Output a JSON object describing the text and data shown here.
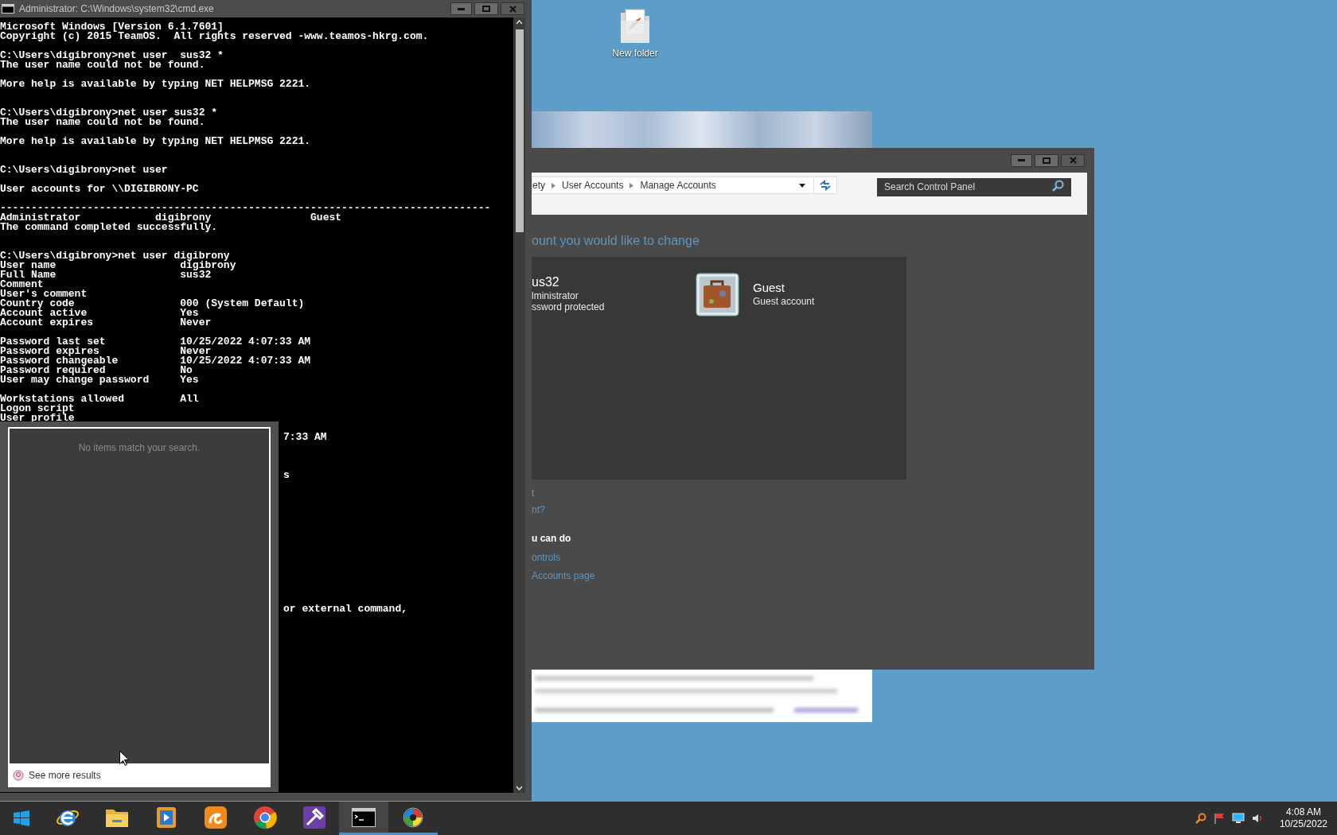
{
  "desktop": {
    "icons": [
      {
        "label": "New folder"
      }
    ]
  },
  "cmd_window": {
    "title": "Administrator: C:\\Windows\\system32\\cmd.exe",
    "lines": [
      {
        "kind": "text",
        "text": "Microsoft Windows [Version 6.1.7601]"
      },
      {
        "kind": "text",
        "text": "Copyright (c) 2015 TeamOS.  All rights reserved -www.teamos-hkrg.com."
      },
      {
        "kind": "blank"
      },
      {
        "kind": "text",
        "text": "C:\\Users\\digibrony>net user  sus32 *"
      },
      {
        "kind": "text",
        "text": "The user name could not be found."
      },
      {
        "kind": "blank"
      },
      {
        "kind": "text",
        "text": "More help is available by typing NET HELPMSG 2221."
      },
      {
        "kind": "blank"
      },
      {
        "kind": "blank"
      },
      {
        "kind": "text",
        "text": "C:\\Users\\digibrony>net user sus32 *"
      },
      {
        "kind": "text",
        "text": "The user name could not be found."
      },
      {
        "kind": "blank"
      },
      {
        "kind": "text",
        "text": "More help is available by typing NET HELPMSG 2221."
      },
      {
        "kind": "blank"
      },
      {
        "kind": "blank"
      },
      {
        "kind": "text",
        "text": "C:\\Users\\digibrony>net user"
      },
      {
        "kind": "blank"
      },
      {
        "kind": "text",
        "text": "User accounts for \\\\DIGIBRONY-PC"
      },
      {
        "kind": "blank"
      },
      {
        "kind": "text",
        "text": "-------------------------------------------------------------------------------"
      },
      {
        "kind": "text",
        "text": "Administrator            digibrony                Guest"
      },
      {
        "kind": "text",
        "text": "The command completed successfully."
      },
      {
        "kind": "blank"
      },
      {
        "kind": "blank"
      },
      {
        "kind": "text",
        "text": "C:\\Users\\digibrony>net user digibrony"
      },
      {
        "kind": "text",
        "text": "User name                    digibrony"
      },
      {
        "kind": "text",
        "text": "Full Name                    sus32"
      },
      {
        "kind": "text",
        "text": "Comment"
      },
      {
        "kind": "text",
        "text": "User's comment"
      },
      {
        "kind": "text",
        "text": "Country code                 000 (System Default)"
      },
      {
        "kind": "text",
        "text": "Account active               Yes"
      },
      {
        "kind": "text",
        "text": "Account expires              Never"
      },
      {
        "kind": "blank"
      },
      {
        "kind": "text",
        "text": "Password last set            10/25/2022 4:07:33 AM"
      },
      {
        "kind": "text",
        "text": "Password expires             Never"
      },
      {
        "kind": "text",
        "text": "Password changeable          10/25/2022 4:07:33 AM"
      },
      {
        "kind": "text",
        "text": "Password required            No"
      },
      {
        "kind": "text",
        "text": "User may change password     Yes"
      },
      {
        "kind": "blank"
      },
      {
        "kind": "text",
        "text": "Workstations allowed         All"
      },
      {
        "kind": "text",
        "text": "Logon script"
      },
      {
        "kind": "text",
        "text": "User profile"
      },
      {
        "kind": "blank"
      },
      {
        "kind": "right",
        "text": "7:33 AM"
      },
      {
        "kind": "blank"
      },
      {
        "kind": "blank"
      },
      {
        "kind": "blank"
      },
      {
        "kind": "right",
        "text": "s"
      },
      {
        "kind": "blank"
      },
      {
        "kind": "blank"
      },
      {
        "kind": "blank"
      },
      {
        "kind": "blank"
      },
      {
        "kind": "blank"
      },
      {
        "kind": "blank"
      },
      {
        "kind": "blank"
      },
      {
        "kind": "blank"
      },
      {
        "kind": "blank"
      },
      {
        "kind": "blank"
      },
      {
        "kind": "blank"
      },
      {
        "kind": "blank"
      },
      {
        "kind": "blank"
      },
      {
        "kind": "right",
        "text": "or external command,"
      }
    ]
  },
  "search_popup": {
    "message": "No items match your search.",
    "see_more": "See more results"
  },
  "control_panel": {
    "breadcrumb": [
      "ety",
      "User Accounts",
      "Manage Accounts"
    ],
    "search": {
      "placeholder": "Search Control Panel"
    },
    "heading": "ount you would like to change",
    "accounts": [
      {
        "kind": "partial",
        "name": "us32",
        "details": [
          "lministrator",
          "ssword protected"
        ]
      },
      {
        "kind": "guest",
        "name": "Guest",
        "details": [
          "Guest account"
        ]
      }
    ],
    "links_top": [
      "t",
      "nt?"
    ],
    "section_title": "u can do",
    "links": [
      "ontrols",
      "Accounts page"
    ]
  },
  "taskbar": {
    "apps": [
      {
        "kind": "e",
        "running": false,
        "active": false
      },
      {
        "kind": "folder",
        "running": false,
        "active": false
      },
      {
        "kind": "media",
        "running": false,
        "active": false
      },
      {
        "kind": "uc",
        "running": false,
        "active": false
      },
      {
        "kind": "chrome",
        "running": false,
        "active": false
      },
      {
        "kind": "tools",
        "running": false,
        "active": false
      },
      {
        "kind": "terminal",
        "running": true,
        "active": true
      },
      {
        "kind": "wheel",
        "running": true,
        "active": false
      }
    ],
    "clock": {
      "time": "4:08 AM",
      "date": "10/25/2022"
    }
  }
}
